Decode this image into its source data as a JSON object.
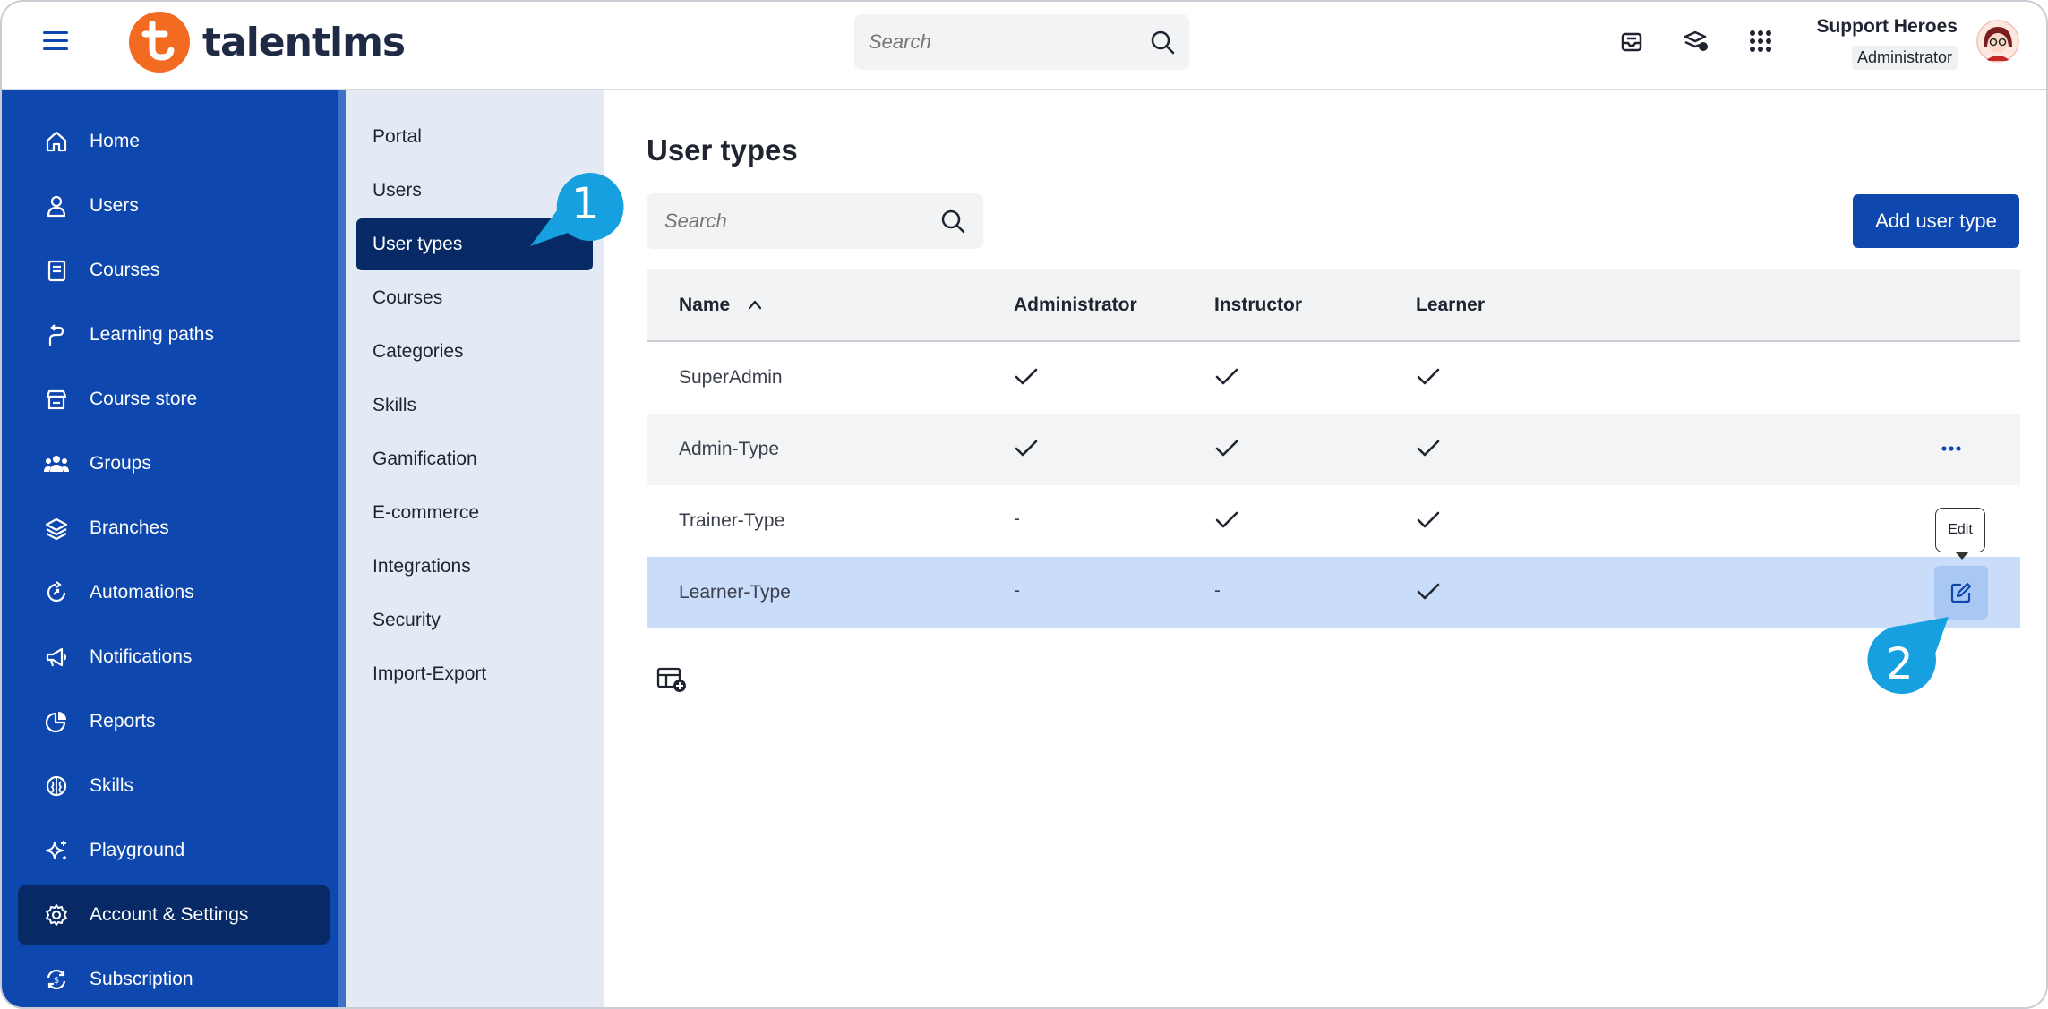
{
  "header": {
    "logo_text": "talentlms",
    "search_placeholder": "Search",
    "user_name": "Support Heroes",
    "user_role": "Administrator"
  },
  "sidebar": {
    "items": [
      {
        "label": "Home",
        "icon": "home-icon"
      },
      {
        "label": "Users",
        "icon": "user-icon"
      },
      {
        "label": "Courses",
        "icon": "book-icon"
      },
      {
        "label": "Learning paths",
        "icon": "path-icon"
      },
      {
        "label": "Course store",
        "icon": "store-icon"
      },
      {
        "label": "Groups",
        "icon": "group-icon"
      },
      {
        "label": "Branches",
        "icon": "layers-icon"
      },
      {
        "label": "Automations",
        "icon": "automation-icon"
      },
      {
        "label": "Notifications",
        "icon": "megaphone-icon"
      },
      {
        "label": "Reports",
        "icon": "pie-chart-icon"
      },
      {
        "label": "Skills",
        "icon": "brain-icon"
      },
      {
        "label": "Playground",
        "icon": "sparkle-icon"
      },
      {
        "label": "Account & Settings",
        "icon": "gear-icon"
      },
      {
        "label": "Subscription",
        "icon": "subscription-icon"
      }
    ],
    "active_index": 12
  },
  "subnav": {
    "items": [
      "Portal",
      "Users",
      "User types",
      "Courses",
      "Categories",
      "Skills",
      "Gamification",
      "E-commerce",
      "Integrations",
      "Security",
      "Import-Export"
    ],
    "active_index": 2
  },
  "main": {
    "title": "User types",
    "search_placeholder": "Search",
    "add_button": "Add user type",
    "columns": [
      "Name",
      "Administrator",
      "Instructor",
      "Learner"
    ],
    "rows": [
      {
        "name": "SuperAdmin",
        "administrator": true,
        "instructor": true,
        "learner": true
      },
      {
        "name": "Admin-Type",
        "administrator": true,
        "instructor": true,
        "learner": true
      },
      {
        "name": "Trainer-Type",
        "administrator": false,
        "instructor": true,
        "learner": true
      },
      {
        "name": "Learner-Type",
        "administrator": false,
        "instructor": false,
        "learner": true
      }
    ],
    "dash_symbol": "-",
    "edit_tooltip": "Edit"
  },
  "callouts": {
    "first": "1",
    "second": "2",
    "color": "#16a0e0"
  },
  "colors": {
    "primary": "#0e47ad",
    "active": "#072a66",
    "selected_row": "#c9dcfa",
    "logo": "#f36b21"
  }
}
